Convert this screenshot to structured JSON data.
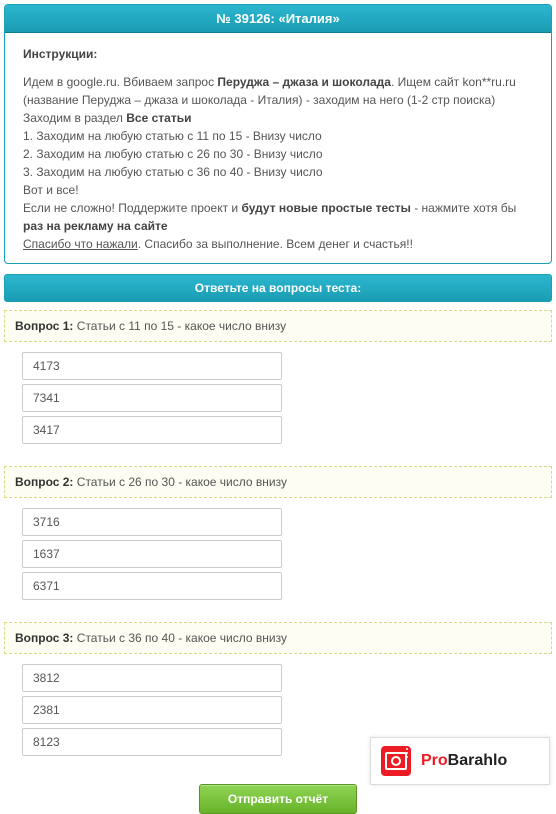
{
  "header": {
    "title": "№ 39126: «Италия»"
  },
  "instructions": {
    "title": "Инструкции:",
    "line1_a": "Идем в google.ru. Вбиваем запрос ",
    "line1_b": "Перуджа – джаза и шоколада",
    "line1_c": ". Ищем сайт kon**ru.ru (название Перуджа – джаза и шоколада - Италия) - заходим на него (1-2 стр поиска)",
    "line2_a": "Заходим в раздел ",
    "line2_b": "Все статьи",
    "step1": "1. Заходим на любую статью с 11 по 15 - Внизу число",
    "step2": "2. Заходим на любую статью с 26 по 30 - Внизу число",
    "step3": "3. Заходим на любую статью с 36 по 40 - Внизу число",
    "tail1": "Вот и все!",
    "tail2_a": "Если не сложно! Поддержите проект и ",
    "tail2_b": "будут новые простые тесты",
    "tail2_c": " - нажмите хотя бы ",
    "tail2_d": "раз на рекламу на сайте",
    "tail3_a": "Спасибо что нажали",
    "tail3_b": ". Спасибо за выполнение. Всем денег и счастья!!"
  },
  "section_title": "Ответьте на вопросы теста:",
  "questions": [
    {
      "label": "Вопрос 1:",
      "text": " Статьи с 11 по 15 - какое число внизу",
      "options": [
        "4173",
        "7341",
        "3417"
      ]
    },
    {
      "label": "Вопрос 2:",
      "text": " Статьи с 26 по 30 - какое число внизу",
      "options": [
        "3716",
        "1637",
        "6371"
      ]
    },
    {
      "label": "Вопрос 3:",
      "text": " Статьи с 36 по 40 - какое число внизу",
      "options": [
        "3812",
        "2381",
        "8123"
      ]
    }
  ],
  "submit_label": "Отправить отчёт",
  "logo": {
    "part1": "Pro",
    "part2": "Barahlo"
  }
}
